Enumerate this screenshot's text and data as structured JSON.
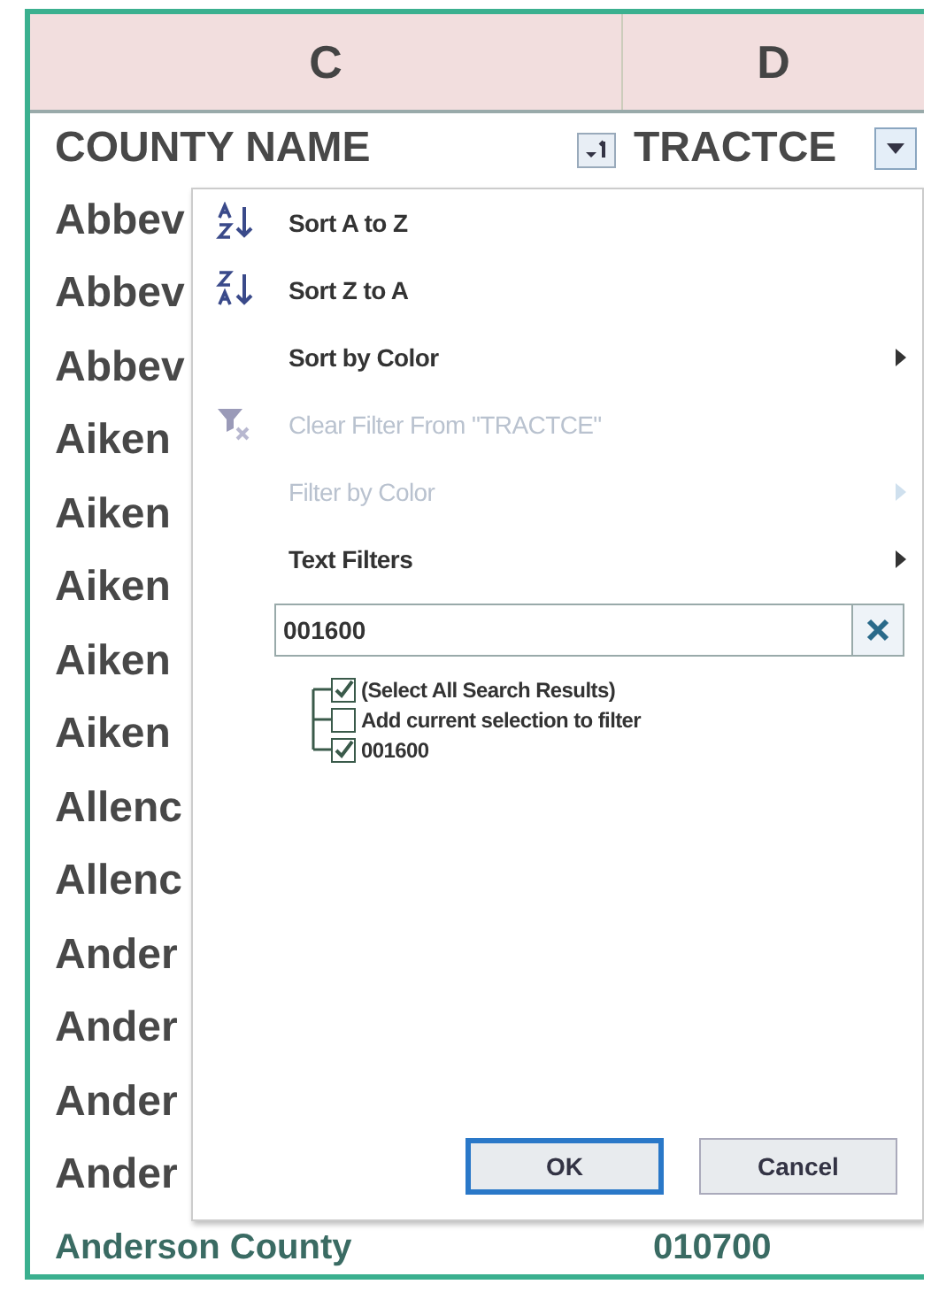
{
  "columns": [
    {
      "letter": "C"
    },
    {
      "letter": "D"
    }
  ],
  "header": {
    "county": "COUNTY NAME",
    "tract": "TRACTCE"
  },
  "rows": [
    {
      "county": "Abbev"
    },
    {
      "county": "Abbev"
    },
    {
      "county": "Abbev"
    },
    {
      "county": "Aiken"
    },
    {
      "county": "Aiken"
    },
    {
      "county": "Aiken"
    },
    {
      "county": "Aiken"
    },
    {
      "county": "Aiken"
    },
    {
      "county": "Allenc"
    },
    {
      "county": "Allenc"
    },
    {
      "county": "Ander"
    },
    {
      "county": "Ander"
    },
    {
      "county": "Ander"
    },
    {
      "county": "Ander"
    },
    {
      "county": "Anderson County",
      "tract": "010700"
    }
  ],
  "filter_menu": {
    "items": [
      {
        "kind": "sort-asc",
        "label": "Sort A to Z",
        "disabled": false,
        "submenu": false
      },
      {
        "kind": "sort-desc",
        "label": "Sort Z to A",
        "disabled": false,
        "submenu": false
      },
      {
        "kind": "plain",
        "label": "Sort by Color",
        "disabled": false,
        "submenu": true
      },
      {
        "kind": "clear-filter",
        "label": "Clear Filter From \"TRACTCE\"",
        "disabled": true,
        "submenu": false
      },
      {
        "kind": "plain",
        "label": "Filter by Color",
        "disabled": true,
        "submenu": true
      },
      {
        "kind": "plain",
        "label": "Text Filters",
        "disabled": false,
        "submenu": true
      }
    ],
    "search": {
      "value": "001600"
    },
    "tree": [
      {
        "label": "(Select All Search Results)",
        "checked": true
      },
      {
        "label": "Add current selection to filter",
        "checked": false
      },
      {
        "label": "001600",
        "checked": true
      }
    ],
    "buttons": [
      {
        "label": "OK",
        "default": true
      },
      {
        "label": "Cancel",
        "default": false
      }
    ]
  }
}
